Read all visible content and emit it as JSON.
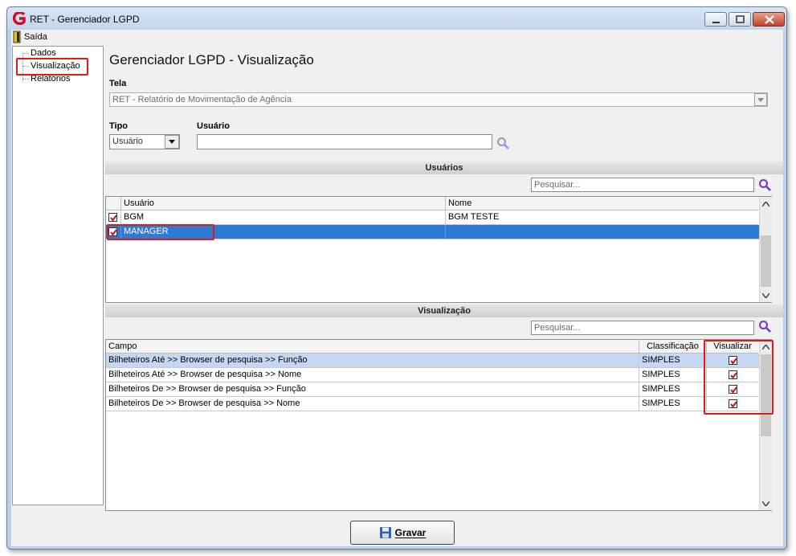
{
  "window": {
    "title": "RET - Gerenciador LGPD"
  },
  "menu": {
    "exit_label": "Saída"
  },
  "tree": {
    "items": [
      "Dados",
      "Visualização",
      "Relatórios"
    ]
  },
  "main": {
    "title": "Gerenciador LGPD - Visualização",
    "tela_label": "Tela",
    "tela_value": "RET - Relatório de Movimentação de Agência",
    "tipo_label": "Tipo",
    "tipo_value": "Usuário",
    "usuario_label": "Usuário",
    "usuario_value": ""
  },
  "usuarios": {
    "header": "Usuários",
    "search_placeholder": "Pesquisar...",
    "columns": [
      "Usuário",
      "Nome"
    ],
    "rows": [
      {
        "usuario": "BGM",
        "nome": "BGM TESTE",
        "checked": true
      },
      {
        "usuario": "MANAGER",
        "nome": "",
        "checked": true
      }
    ]
  },
  "visualizacao": {
    "header": "Visualização",
    "search_placeholder": "Pesquisar...",
    "columns": [
      "Campo",
      "Classificação",
      "Visualizar"
    ],
    "rows": [
      {
        "campo": "Bilheteiros Até >> Browser de pesquisa >> Função",
        "classificacao": "SIMPLES",
        "visualizar": true
      },
      {
        "campo": "Bilheteiros Até >> Browser de pesquisa >> Nome",
        "classificacao": "SIMPLES",
        "visualizar": true
      },
      {
        "campo": "Bilheteiros De >> Browser de pesquisa >> Função",
        "classificacao": "SIMPLES",
        "visualizar": true
      },
      {
        "campo": "Bilheteiros De >> Browser de pesquisa >> Nome",
        "classificacao": "SIMPLES",
        "visualizar": true
      }
    ]
  },
  "footer": {
    "save_label": "Gravar"
  },
  "colors": {
    "selection": "#2f7bd3",
    "highlight": "#c7d6f3",
    "annotation": "#e01919",
    "search_icon": "#7b2fd6"
  }
}
